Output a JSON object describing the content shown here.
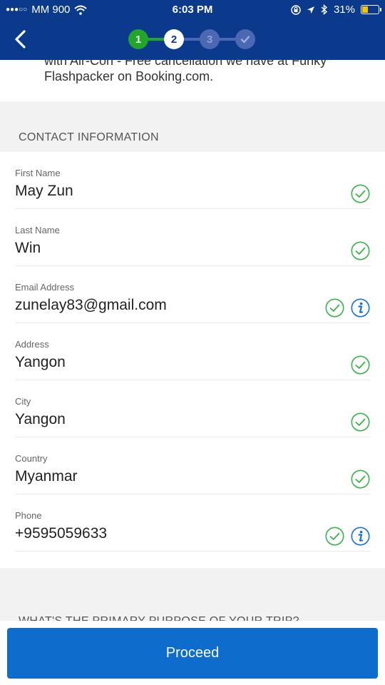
{
  "status_bar": {
    "carrier": "MM 900",
    "time": "6:03 PM",
    "battery": "31%",
    "icons": [
      "signal-dots-icon",
      "wifi-icon",
      "lock-rotation-icon",
      "location-arrow-icon",
      "bluetooth-icon",
      "battery-icon"
    ]
  },
  "nav": {
    "steps": [
      {
        "label": "1",
        "state": "complete"
      },
      {
        "label": "2",
        "state": "current"
      },
      {
        "label": "3",
        "state": "upcoming"
      },
      {
        "label": "",
        "icon": "check-icon",
        "state": "upcoming"
      }
    ],
    "colors": {
      "bar": "#0b3a8c",
      "complete": "#22a52a",
      "upcoming": "#4d68b3"
    }
  },
  "booking_summary": {
    "text": "with Air-Con - Free cancellation we have at Funky Flashpacker on Booking.com."
  },
  "contact": {
    "section_title": "CONTACT INFORMATION",
    "fields": [
      {
        "label": "First Name",
        "value": "May Zun",
        "valid": true,
        "info": false
      },
      {
        "label": "Last Name",
        "value": "Win",
        "valid": true,
        "info": false
      },
      {
        "label": "Email Address",
        "value": "zunelay83@gmail.com",
        "valid": true,
        "info": true
      },
      {
        "label": "Address",
        "value": "Yangon",
        "valid": true,
        "info": false
      },
      {
        "label": "City",
        "value": "Yangon",
        "valid": true,
        "info": false
      },
      {
        "label": "Country",
        "value": "Myanmar",
        "valid": true,
        "info": false
      },
      {
        "label": "Phone",
        "value": "+9595059633",
        "valid": true,
        "info": true
      }
    ]
  },
  "trip_purpose": {
    "section_title": "WHAT'S THE PRIMARY PURPOSE OF YOUR TRIP?"
  },
  "footer": {
    "proceed_label": "Proceed",
    "button_color": "#0e6dcc"
  }
}
